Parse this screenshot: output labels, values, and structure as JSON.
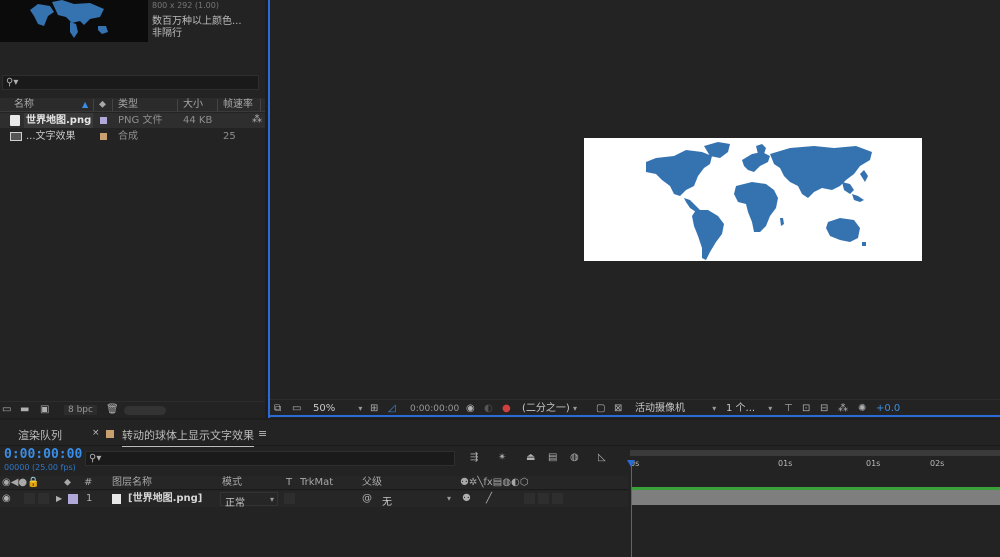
{
  "project_panel": {
    "thumbnail_info_line1": "800 x 292 (1.00)",
    "thumbnail_info_line2": "数百万种以上颜色...",
    "thumbnail_info_line3": "非隔行",
    "search_placeholder": "",
    "columns": [
      "名称",
      "类型",
      "大小",
      "帧速率"
    ],
    "items": [
      {
        "name": "世界地图.png",
        "type": "PNG 文件",
        "size": "44 KB",
        "fps": "",
        "label_color": "#b0a8d8"
      },
      {
        "name": "...文字效果",
        "type": "合成",
        "size": "",
        "fps": "25",
        "label_color": "#c8a070"
      }
    ],
    "bit_depth": "8 bpc"
  },
  "viewer_toolbar": {
    "zoom": "50%",
    "timecode": "0:00:00:00",
    "resolution": "(二分之一)",
    "camera": "活动摄像机",
    "views": "1 个...",
    "exposure": "+0.0"
  },
  "timeline": {
    "tab_render_queue": "渲染队列",
    "tab_comp": "转动的球体上显示文字效果",
    "comp_label_color": "#c8a070",
    "current_time": "0:00:00:00",
    "fps_info": "00000 (25.00 fps)",
    "columns": {
      "label": "#",
      "layer_name": "图层名称",
      "mode": "模式",
      "t": "T",
      "trkmat": "TrkMat",
      "parent": "父级"
    },
    "layer": {
      "index": "1",
      "name": "[世界地图.png]",
      "mode": "正常",
      "parent": "无",
      "label_color": "#b0a8d8"
    },
    "ruler_ticks": [
      "0s",
      "01s",
      "01s",
      "02s"
    ]
  },
  "colors": {
    "accent": "#2a6bd6",
    "timecode": "#3a8ee8",
    "map_blue": "#3572b0"
  }
}
